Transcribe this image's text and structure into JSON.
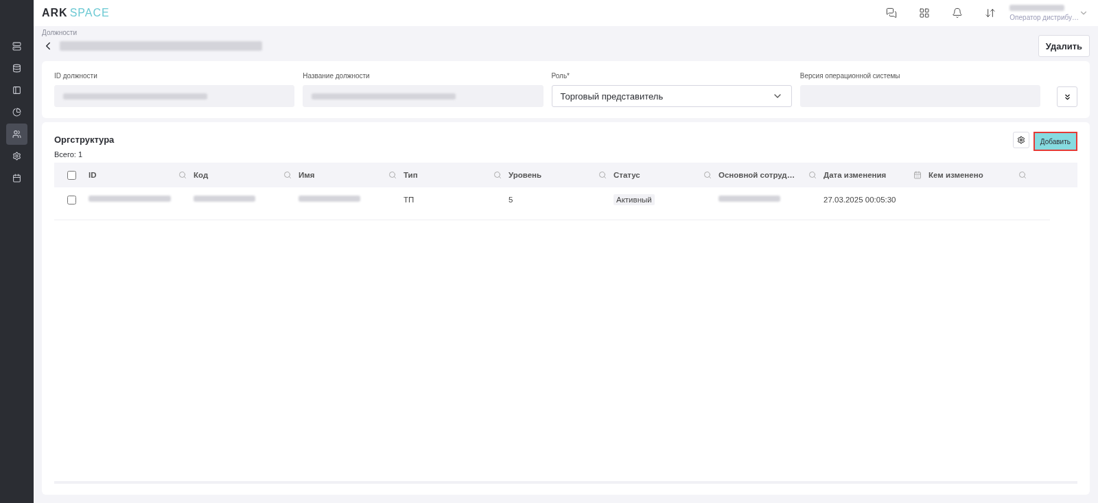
{
  "logo": {
    "primary": "ARK",
    "secondary": "SPACE"
  },
  "sidebar": {
    "items": [
      {
        "selected": false
      },
      {
        "selected": false
      },
      {
        "selected": false
      },
      {
        "selected": false
      },
      {
        "selected": true
      },
      {
        "selected": false
      },
      {
        "selected": false
      }
    ]
  },
  "topbar": {
    "user": {
      "role": "Оператор дистрибу…"
    }
  },
  "breadcrumb": "Должности",
  "delete_button": "Удалить",
  "form": {
    "fields": [
      {
        "label": "ID должности",
        "kind": "readonly"
      },
      {
        "label": "Название должности",
        "kind": "readonly"
      },
      {
        "label": "Роль*",
        "kind": "select",
        "value": "Торговый представитель"
      },
      {
        "label": "Версия операционной системы",
        "kind": "readonly"
      }
    ]
  },
  "org": {
    "title": "Оргструктура",
    "total": "Всего: 1",
    "add_button": "Добавить",
    "table": {
      "header_checked": false,
      "columns": [
        {
          "label": "ID",
          "kind": "search"
        },
        {
          "label": "Код",
          "kind": "search"
        },
        {
          "label": "Имя",
          "kind": "search"
        },
        {
          "label": "Тип",
          "kind": "search"
        },
        {
          "label": "Уровень",
          "kind": "search"
        },
        {
          "label": "Статус",
          "kind": "search"
        },
        {
          "label": "Основной сотруд…",
          "kind": "search"
        },
        {
          "label": "Дата изменения",
          "kind": "date"
        },
        {
          "label": "Кем изменено",
          "kind": "search"
        }
      ],
      "rows": [
        {
          "checked": false,
          "cells": [
            {
              "kind": "hidden"
            },
            {
              "kind": "hidden"
            },
            {
              "kind": "hidden"
            },
            {
              "kind": "text",
              "text": "ТП"
            },
            {
              "kind": "text",
              "text": "5"
            },
            {
              "kind": "tag",
              "text": "Активный"
            },
            {
              "kind": "hidden"
            },
            {
              "kind": "text",
              "text": "27.03.2025 00:05:30"
            },
            {
              "kind": "empty"
            }
          ]
        }
      ]
    }
  }
}
